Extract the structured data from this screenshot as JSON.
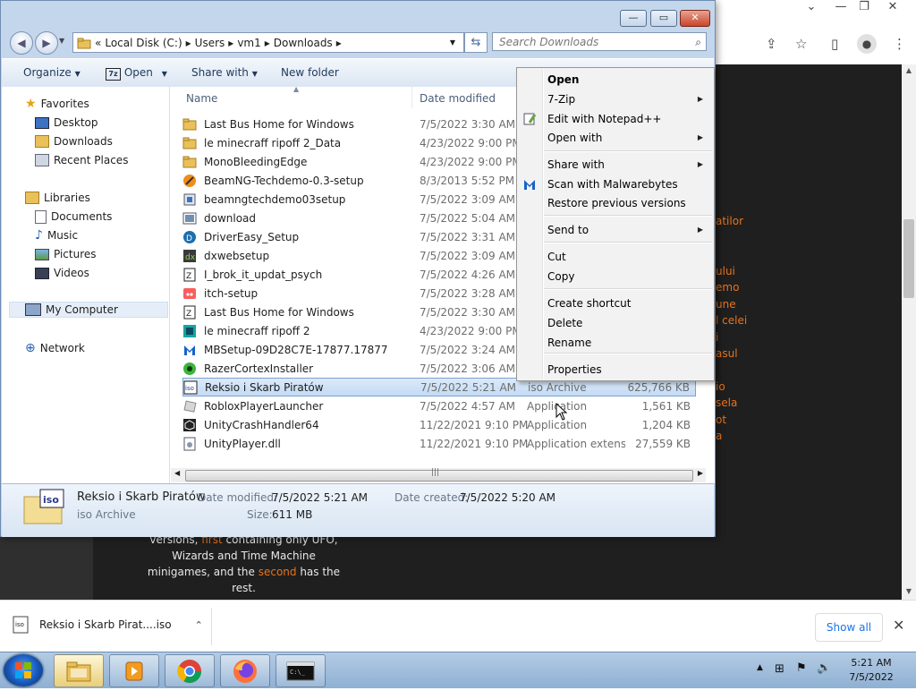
{
  "explorer": {
    "window_controls": {
      "minimize": "—",
      "maximize": "▭",
      "close": "✕"
    },
    "breadcrumb": {
      "chevron": "«",
      "parts": [
        "Local Disk (C:)",
        "Users",
        "vm1",
        "Downloads"
      ]
    },
    "search": {
      "placeholder": "Search Downloads"
    },
    "toolbar": {
      "organize": "Organize",
      "open": "Open",
      "share_with": "Share with",
      "new_folder": "New folder"
    },
    "nav": {
      "favorites": "Favorites",
      "desktop": "Desktop",
      "downloads": "Downloads",
      "recent_places": "Recent Places",
      "libraries": "Libraries",
      "documents": "Documents",
      "music": "Music",
      "pictures": "Pictures",
      "videos": "Videos",
      "my_computer": "My Computer",
      "network": "Network"
    },
    "columns": {
      "name": "Name",
      "date_modified": "Date modified"
    },
    "files": [
      {
        "name": "Last Bus Home for Windows",
        "date": "7/5/2022 3:30 AM",
        "type": "",
        "size": "",
        "icon": "folder-icon"
      },
      {
        "name": "le minecraff ripoff 2_Data",
        "date": "4/23/2022 9:00 PM",
        "type": "",
        "size": "",
        "icon": "folder-icon"
      },
      {
        "name": "MonoBleedingEdge",
        "date": "4/23/2022 9:00 PM",
        "type": "",
        "size": "",
        "icon": "folder-icon"
      },
      {
        "name": "BeamNG-Techdemo-0.3-setup",
        "date": "8/3/2013 5:52 PM",
        "type": "",
        "size": "",
        "icon": "beamng-icon"
      },
      {
        "name": "beamngtechdemo03setup",
        "date": "7/5/2022 3:09 AM",
        "type": "",
        "size": "",
        "icon": "setup-icon"
      },
      {
        "name": "download",
        "date": "7/5/2022 5:04 AM",
        "type": "",
        "size": "",
        "icon": "image-file-icon"
      },
      {
        "name": "DriverEasy_Setup",
        "date": "7/5/2022 3:31 AM",
        "type": "",
        "size": "",
        "icon": "drivereasy-icon"
      },
      {
        "name": "dxwebsetup",
        "date": "7/5/2022 3:09 AM",
        "type": "",
        "size": "",
        "icon": "directx-icon"
      },
      {
        "name": "I_brok_it_updat_psych",
        "date": "7/5/2022 4:26 AM",
        "type": "",
        "size": "",
        "icon": "zip-icon"
      },
      {
        "name": "itch-setup",
        "date": "7/5/2022 3:28 AM",
        "type": "",
        "size": "",
        "icon": "itch-icon"
      },
      {
        "name": "Last Bus Home for Windows",
        "date": "7/5/2022 3:30 AM",
        "type": "",
        "size": "",
        "icon": "zip-icon"
      },
      {
        "name": "le minecraff ripoff 2",
        "date": "4/23/2022 9:00 PM",
        "type": "",
        "size": "",
        "icon": "unity-game-icon"
      },
      {
        "name": "MBSetup-09D28C7E-17877.17877",
        "date": "7/5/2022 3:24 AM",
        "type": "",
        "size": "",
        "icon": "malwarebytes-icon"
      },
      {
        "name": "RazerCortexInstaller",
        "date": "7/5/2022 3:06 AM",
        "type": "",
        "size": "",
        "icon": "razer-icon"
      },
      {
        "name": "Reksio i Skarb Piratów",
        "date": "7/5/2022 5:21 AM",
        "type": "iso Archive",
        "size": "625,766 KB",
        "icon": "iso-icon",
        "selected": true
      },
      {
        "name": "RobloxPlayerLauncher",
        "date": "7/5/2022 4:57 AM",
        "type": "Application",
        "size": "1,561 KB",
        "icon": "roblox-icon"
      },
      {
        "name": "UnityCrashHandler64",
        "date": "11/22/2021 9:10 PM",
        "type": "Application",
        "size": "1,204 KB",
        "icon": "unity-icon"
      },
      {
        "name": "UnityPlayer.dll",
        "date": "11/22/2021 9:10 PM",
        "type": "Application extens...",
        "size": "27,559 KB",
        "icon": "dll-icon"
      }
    ],
    "details": {
      "name": "Reksio i Skarb Piratów",
      "type": "iso Archive",
      "date_modified_label": "Date modified:",
      "date_modified": "7/5/2022 5:21 AM",
      "date_created_label": "Date created:",
      "date_created": "7/5/2022 5:20 AM",
      "size_label": "Size:",
      "size": "611 MB"
    }
  },
  "context_menu": {
    "items": [
      {
        "label": "Open",
        "bold": true,
        "submenu": false
      },
      {
        "label": "7-Zip",
        "submenu": true
      },
      {
        "label": "Edit with Notepad++",
        "submenu": false,
        "icon": "notepadpp-icon"
      },
      {
        "label": "Open with",
        "submenu": true
      },
      {
        "label": "Share with",
        "submenu": true
      },
      {
        "label": "Scan with Malwarebytes",
        "submenu": false,
        "icon": "malwarebytes-icon"
      },
      {
        "label": "Restore previous versions",
        "submenu": false
      },
      {
        "label": "Send to",
        "submenu": true
      },
      {
        "label": "Cut",
        "submenu": false
      },
      {
        "label": "Copy",
        "submenu": false
      },
      {
        "label": "Create shortcut",
        "submenu": false
      },
      {
        "label": "Delete",
        "submenu": false
      },
      {
        "label": "Rename",
        "submenu": false
      },
      {
        "label": "Properties",
        "submenu": false
      }
    ]
  },
  "background_page": {
    "orange_fragments": [
      "atilor",
      "ului",
      "emo",
      "une",
      "l celei",
      "i",
      "asul",
      "io",
      "sela",
      "ot",
      "a"
    ],
    "article": {
      "prefix": "versions, ",
      "first": "first",
      "mid1": " containing only UFO, Wizards and Time Machine minigames, and the ",
      "second": "second",
      "mid2": " has the rest."
    }
  },
  "download_bar": {
    "filename": "Reksio i Skarb Pirat....iso",
    "show_all": "Show all"
  },
  "taskbar": {
    "clock_time": "5:21 AM",
    "clock_date": "7/5/2022"
  },
  "colors": {
    "accent": "#1a73e8",
    "link_orange": "#e8731c",
    "selection": "#c3dbf5"
  }
}
